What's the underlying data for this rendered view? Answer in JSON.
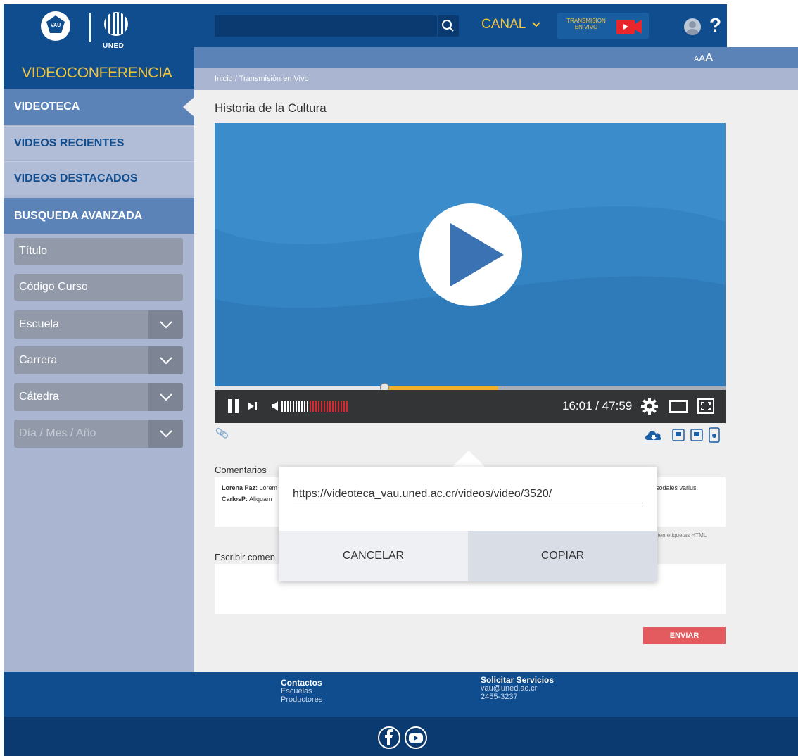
{
  "header": {
    "site_title": "VIDEOCONFERENCIA",
    "logo_vau_text": "VAU",
    "logo_uned_text": "UNED",
    "search_placeholder": "",
    "canal_label": "CANAL",
    "live_label": "TRANSMISION EN VIVO",
    "help_label": "?",
    "font_size_control": [
      "A",
      "A",
      "A"
    ]
  },
  "breadcrumb": {
    "home": "Inicio",
    "separator": "/",
    "current": "Transmisión en Vivo"
  },
  "sidebar": {
    "items": [
      {
        "label": "VIDEOTECA"
      },
      {
        "label": "VIDEOS RECIENTES"
      },
      {
        "label": "VIDEOS DESTACADOS"
      },
      {
        "label": "BUSQUEDA AVANZADA"
      }
    ],
    "fields": {
      "titulo": "Título",
      "codigo": "Código Curso"
    },
    "selects": {
      "escuela": "Escuela",
      "carrera": "Carrera",
      "catedra": "Cátedra",
      "fecha": "Día / Mes / Año"
    }
  },
  "video": {
    "title": "Historia de la Cultura",
    "time_readout": "16:01 / 47:59",
    "progress_played": 0.332,
    "progress_buffered": 0.555
  },
  "comments": {
    "label": "Comentarios",
    "items": [
      {
        "author": "Lorena Paz:",
        "text": "Lorem"
      },
      {
        "author": "CarlosP:",
        "text": "Aliquam"
      }
    ],
    "tail_text": "sodales varius.",
    "html_note": "miten etiquetas HTML",
    "write_label": "Escribir comen",
    "send_label": "ENVIAR"
  },
  "share_dialog": {
    "url": "https://videoteca_vau.uned.ac.cr/videos/video/3520/",
    "cancel_label": "CANCELAR",
    "copy_label": "COPIAR"
  },
  "footer": {
    "contactos": {
      "head": "Contactos",
      "lines": [
        "Escuelas",
        "Productores"
      ]
    },
    "servicios": {
      "head": "Solicitar Servicios",
      "lines": [
        "vau@uned.ac.cr",
        "2455-3237"
      ]
    },
    "social": [
      "facebook-icon",
      "youtube-icon"
    ]
  },
  "colors": {
    "primary_blue": "#0f4d8f",
    "accent_yellow": "#f3c43a",
    "send_red": "#e45b5f",
    "player_blue": "#3a8ccb"
  }
}
